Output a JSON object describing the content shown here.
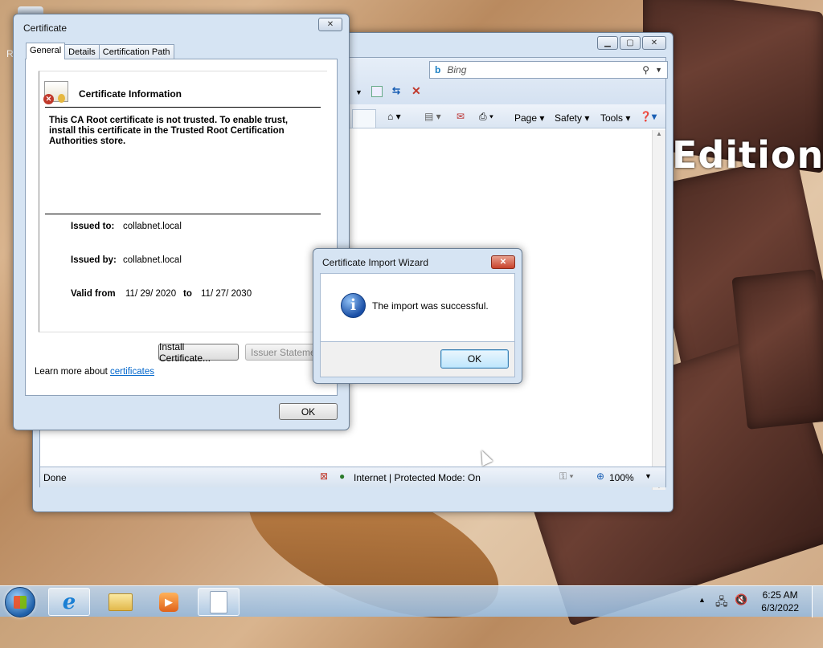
{
  "desktop": {
    "edition_text": "Edition",
    "left_char": "R"
  },
  "ie": {
    "search_placeholder": "Bing",
    "cmd_page": "Page ▾",
    "cmd_safety": "Safety ▾",
    "cmd_tools": "Tools ▾",
    "status_text": "Done",
    "zone_text": "Internet | Protected Mode: On",
    "zoom": "100%"
  },
  "cert": {
    "title": "Certificate",
    "tabs": [
      "General",
      "Details",
      "Certification Path"
    ],
    "info_heading": "Certificate Information",
    "warning": "This CA Root certificate is not trusted. To enable trust, install this certificate in the Trusted Root Certification Authorities store.",
    "issued_to_label": "Issued to:",
    "issued_to_value": "collabnet.local",
    "issued_by_label": "Issued by:",
    "issued_by_value": "collabnet.local",
    "valid_label": "Valid from",
    "valid_from": "11/ 29/ 2020",
    "valid_to_label": "to",
    "valid_to": "11/ 27/ 2030",
    "install_button": "Install Certificate...",
    "issuer_button": "Issuer Statement",
    "learn_more": "Learn more about",
    "learn_link": "certificates",
    "ok_button": "OK"
  },
  "wizard": {
    "title": "Certificate Import Wizard",
    "message": "The import was successful.",
    "ok_button": "OK"
  },
  "taskbar": {
    "time": "6:25 AM",
    "date": "6/3/2022"
  },
  "colors": {
    "accent": "#3c7fb1",
    "link": "#0066cc",
    "close_red": "#c8432c"
  }
}
